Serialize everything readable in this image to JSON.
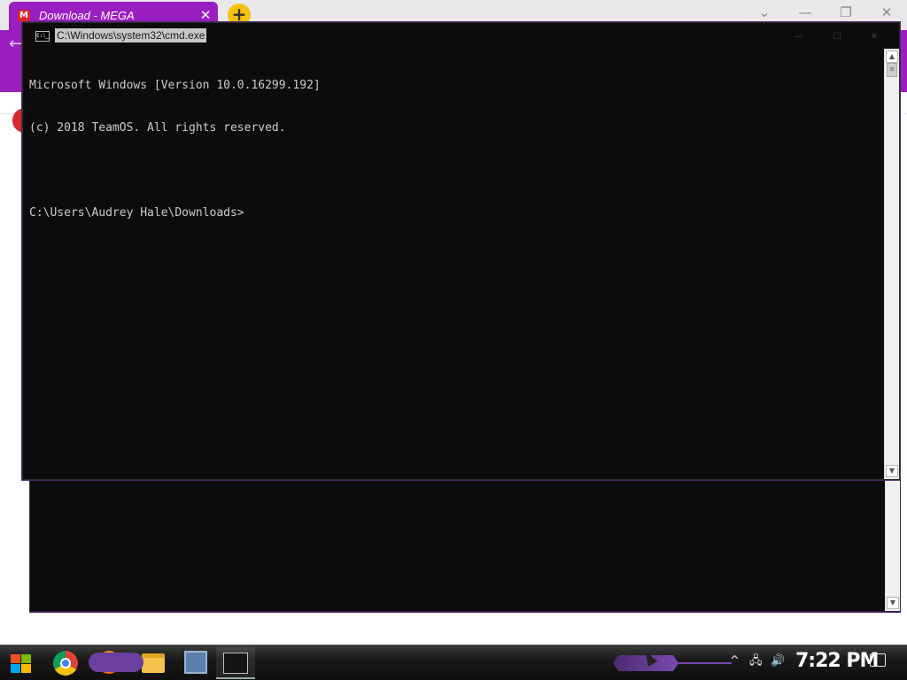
{
  "browser": {
    "tab_title": "Download - MEGA",
    "tab_favicon": "M",
    "tab_close": "✕",
    "new_tab": "+",
    "controls": {
      "dropdown": "⌄",
      "minimize": "—",
      "restore": "❐",
      "close": "✕"
    },
    "back": "←"
  },
  "cmd": {
    "title": "C:\\Windows\\system32\\cmd.exe",
    "icon_text": "C:\\_",
    "controls": {
      "minimize": "—",
      "maximize": "☐",
      "close": "✕"
    },
    "lines": [
      "Microsoft Windows [Version 10.0.16299.192]",
      "(c) 2018 TeamOS. All rights reserved.",
      "",
      "C:\\Users\\Audrey Hale\\Downloads>"
    ],
    "scroll_up": "▲",
    "scroll_down": "▼",
    "thumb_grip": "≡"
  },
  "taskbar": {
    "clock": "7:22 PM",
    "tray_chevron": "^",
    "tray_network": "🖧",
    "tray_volume": "🔊",
    "colors": {
      "accent": "#9a1ec0",
      "cmd_bg": "#0c0c0c",
      "console_text": "#cccccc"
    },
    "icons": [
      "start-icon",
      "chrome-icon",
      "firefox-icon",
      "folder-icon",
      "control-panel-icon",
      "cmd-icon"
    ]
  }
}
